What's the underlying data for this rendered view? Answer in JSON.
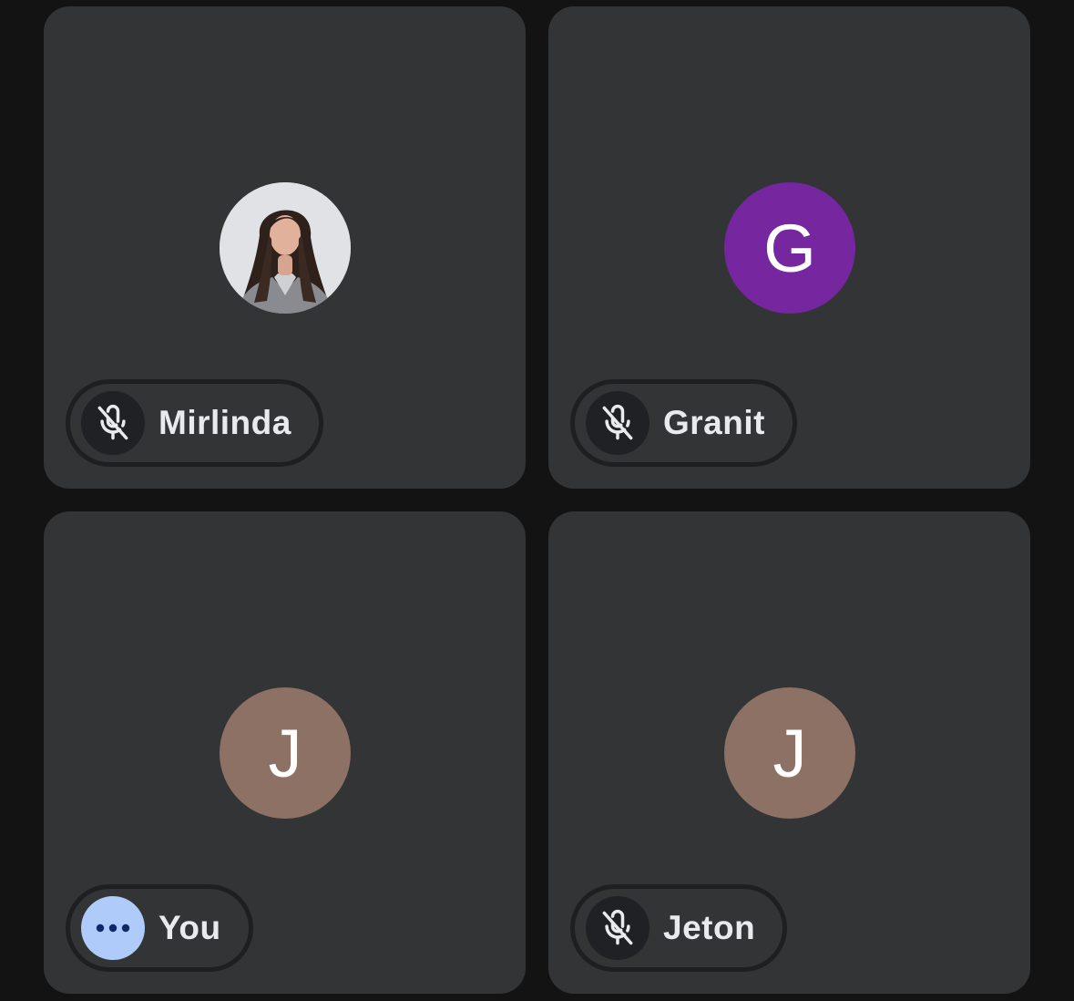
{
  "participants": [
    {
      "name": "Mirlinda",
      "avatar_type": "photo",
      "avatar_letter": "",
      "avatar_color": "#dcdde1",
      "status_icon": "mic-off-icon"
    },
    {
      "name": "Granit",
      "avatar_type": "letter",
      "avatar_letter": "G",
      "avatar_color": "#7627a0",
      "status_icon": "mic-off-icon"
    },
    {
      "name": "You",
      "avatar_type": "letter",
      "avatar_letter": "J",
      "avatar_color": "#8d7164",
      "status_icon": "more-dots-icon"
    },
    {
      "name": "Jeton",
      "avatar_type": "letter",
      "avatar_letter": "J",
      "avatar_color": "#8d7164",
      "status_icon": "mic-off-icon"
    }
  ],
  "colors": {
    "background": "#131313",
    "tile": "#333436",
    "pill_border": "#1e1f21",
    "status_circle": "#202124",
    "speaking_circle": "#aecbfa",
    "name_text": "#e8eaed"
  }
}
